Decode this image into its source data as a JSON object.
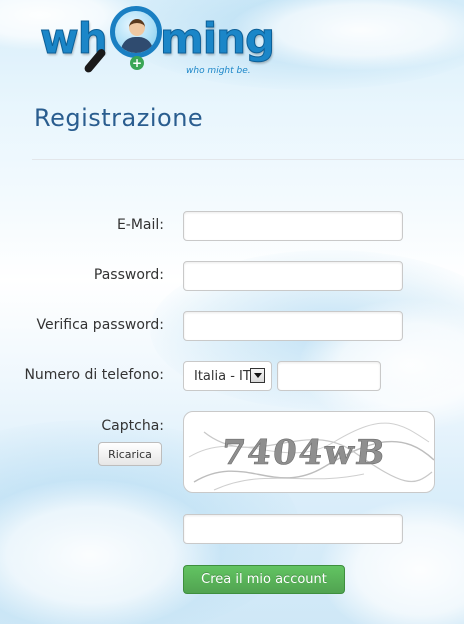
{
  "logo": {
    "text_left": "wh",
    "text_right": "ming",
    "tagline": "who might be."
  },
  "title": "Registrazione",
  "form": {
    "email_label": "E-Mail:",
    "email_value": "",
    "password_label": "Password:",
    "password_value": "",
    "verify_label": "Verifica password:",
    "verify_value": "",
    "phone_label": "Numero di telefono:",
    "country_selected": "Italia - IT",
    "phone_value": "",
    "captcha_label": "Captcha:",
    "reload_label": "Ricarica",
    "captcha_text": "7404wB",
    "captcha_value": "",
    "submit_label": "Crea il mio account"
  }
}
